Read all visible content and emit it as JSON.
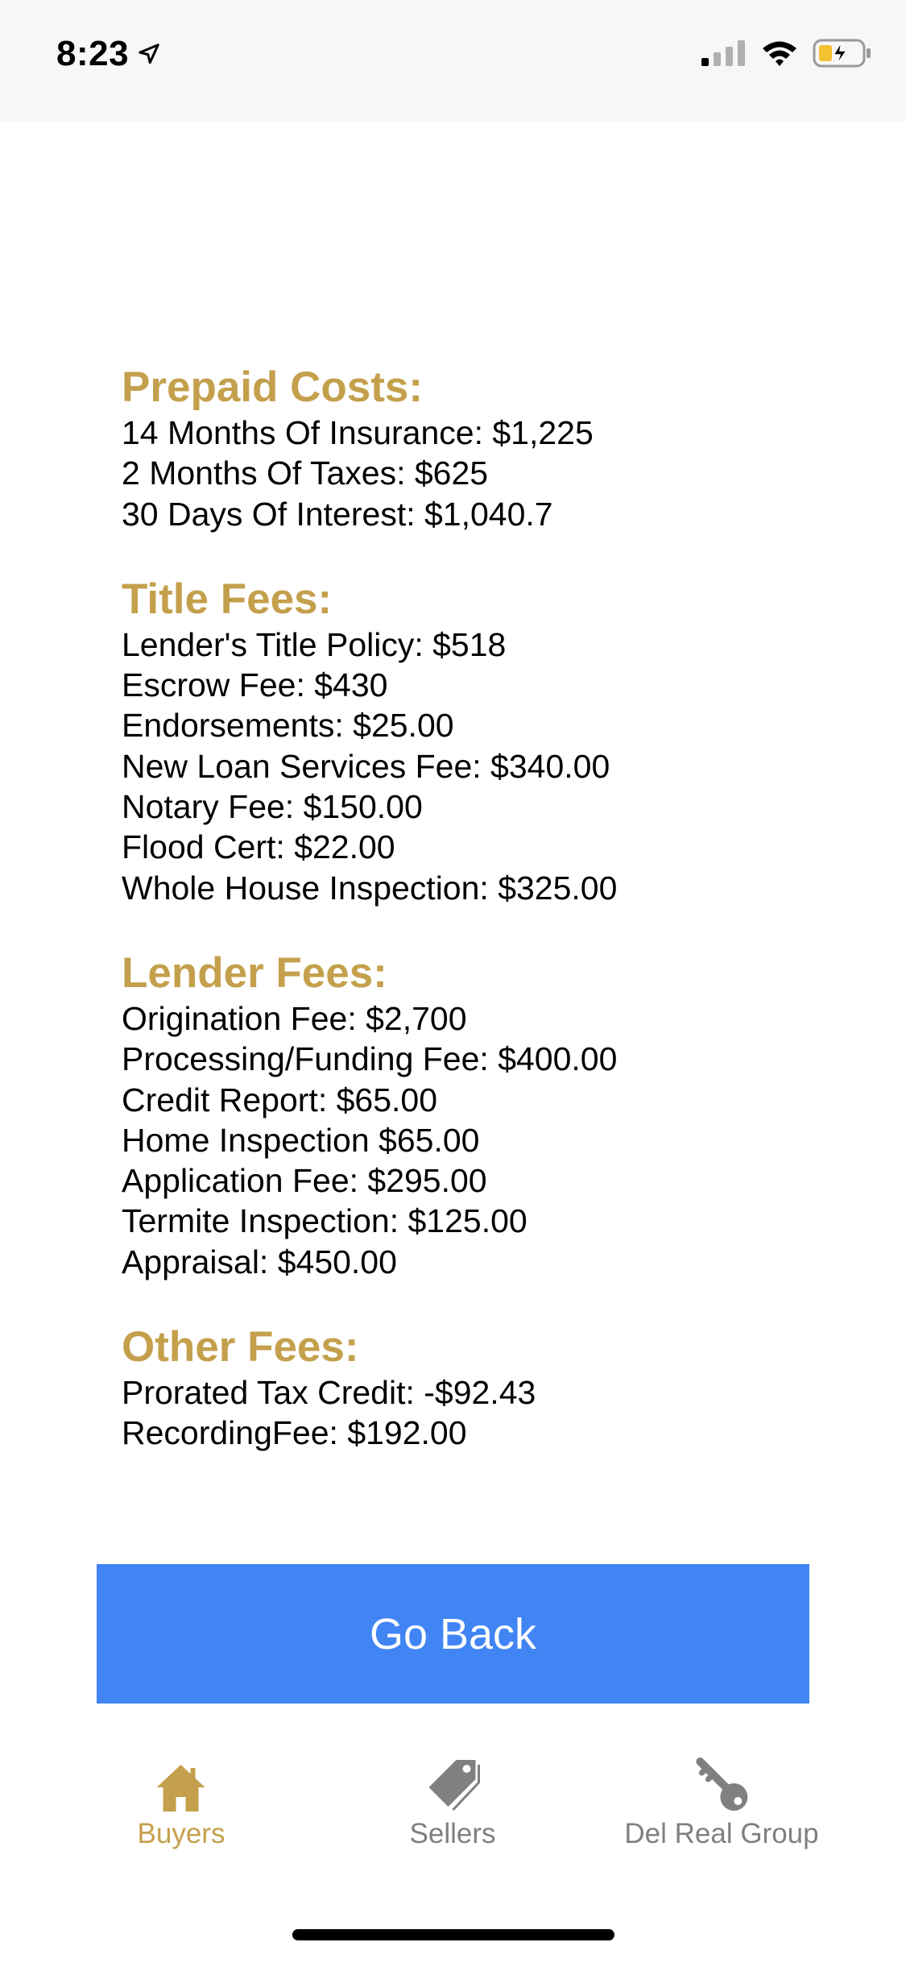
{
  "status_bar": {
    "time": "8:23",
    "icons": [
      "location-arrow-icon",
      "cellular-signal-icon",
      "wifi-icon",
      "battery-charging-icon"
    ]
  },
  "colors": {
    "accent": "#c4a04c",
    "button": "#4185f4",
    "tab_inactive": "#808080"
  },
  "sections": [
    {
      "title": "Prepaid Costs:",
      "items": [
        "14 Months Of Insurance: $1,225",
        "2 Months Of Taxes: $625",
        "30 Days Of Interest: $1,040.7"
      ]
    },
    {
      "title": "Title Fees:",
      "items": [
        "Lender's Title Policy: $518",
        "Escrow Fee: $430",
        "Endorsements: $25.00",
        "New Loan Services Fee: $340.00",
        "Notary Fee: $150.00",
        "Flood Cert: $22.00",
        "Whole House Inspection: $325.00"
      ]
    },
    {
      "title": "Lender Fees:",
      "items": [
        "Origination Fee: $2,700",
        "Processing/Funding Fee: $400.00",
        "Credit Report: $65.00",
        "Home Inspection $65.00",
        "Application Fee: $295.00",
        "Termite Inspection: $125.00",
        "Appraisal: $450.00"
      ]
    },
    {
      "title": "Other Fees:",
      "items": [
        "Prorated Tax Credit: -$92.43",
        "RecordingFee: $192.00"
      ]
    }
  ],
  "go_back_label": "Go Back",
  "tabs": [
    {
      "label": "Buyers",
      "icon": "house-icon",
      "active": true
    },
    {
      "label": "Sellers",
      "icon": "price-tag-icon",
      "active": false
    },
    {
      "label": "Del Real Group",
      "icon": "key-icon",
      "active": false
    }
  ]
}
